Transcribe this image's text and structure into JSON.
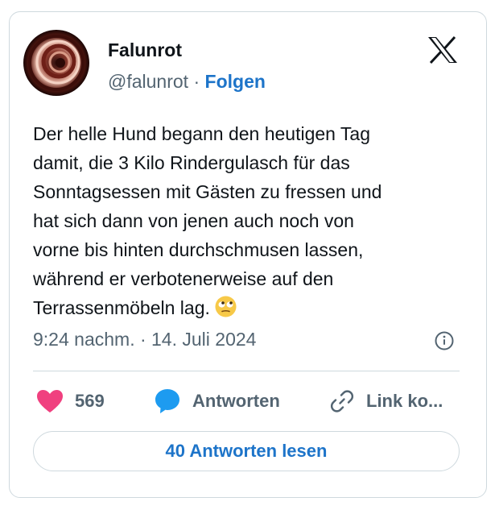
{
  "author": {
    "name": "Falunrot",
    "handle": "@falunrot",
    "separator": "·",
    "follow_label": "Folgen"
  },
  "post": {
    "lines": [
      "Der helle Hund begann den heutigen Tag",
      "damit, die 3 Kilo Rindergulasch für das",
      "Sonntagsessen mit Gästen zu fressen und",
      "hat sich dann von jenen auch noch von",
      "vorne bis hinten durchschmusen lassen,",
      "während er verbotenerweise auf den",
      "Terrassenmöbeln lag."
    ],
    "emoji": "face-with-rolling-eyes",
    "timestamp": "9:24 nachm. · 14. Juli 2024"
  },
  "actions": {
    "likes": "569",
    "reply_label": "Antworten",
    "copy_link_label": "Link ko..."
  },
  "read_replies_label": "40 Antworten lesen",
  "colors": {
    "accent": "#1d74c9",
    "like": "#f0407f",
    "reply": "#1d9bf0",
    "border": "#cfd9de",
    "muted": "#536471"
  },
  "icons": [
    "x-logo-icon",
    "heart-icon",
    "speech-bubble-icon",
    "link-icon",
    "info-icon"
  ]
}
